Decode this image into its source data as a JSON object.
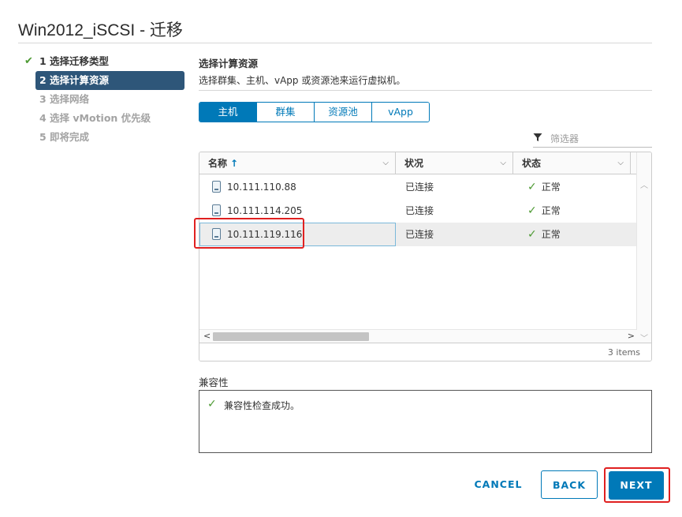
{
  "dialog": {
    "title": "Win2012_iSCSI - 迁移"
  },
  "steps": [
    {
      "label": "1 选择迁移类型",
      "state": "done"
    },
    {
      "label": "2 选择计算资源",
      "state": "active"
    },
    {
      "label": "3 选择网络",
      "state": "pending"
    },
    {
      "label": "4 选择 vMotion 优先级",
      "state": "pending"
    },
    {
      "label": "5 即将完成",
      "state": "pending"
    }
  ],
  "section": {
    "title": "选择计算资源",
    "description": "选择群集、主机、vApp 或资源池来运行虚拟机。"
  },
  "tabs": [
    {
      "label": "主机",
      "selected": true
    },
    {
      "label": "群集",
      "selected": false
    },
    {
      "label": "资源池",
      "selected": false
    },
    {
      "label": "vApp",
      "selected": false
    }
  ],
  "filter": {
    "placeholder": "筛选器",
    "icon": "filter-icon"
  },
  "grid": {
    "columns": [
      {
        "label": "名称",
        "sort": "ascending"
      },
      {
        "label": "状况"
      },
      {
        "label": "状态"
      }
    ],
    "rows": [
      {
        "name": "10.111.110.88",
        "condition": "已连接",
        "status": "正常",
        "selected": false
      },
      {
        "name": "10.111.114.205",
        "condition": "已连接",
        "status": "正常",
        "selected": false
      },
      {
        "name": "10.111.119.116",
        "condition": "已连接",
        "status": "正常",
        "selected": true
      }
    ],
    "item_count": "3 items"
  },
  "compatibility": {
    "label": "兼容性",
    "message": "兼容性检查成功。"
  },
  "buttons": {
    "cancel": "CANCEL",
    "back": "BACK",
    "next": "NEXT"
  },
  "colors": {
    "accent": "#0079b8",
    "active_step": "#2e5679",
    "success": "#4d9a33",
    "highlight": "#e02020"
  }
}
